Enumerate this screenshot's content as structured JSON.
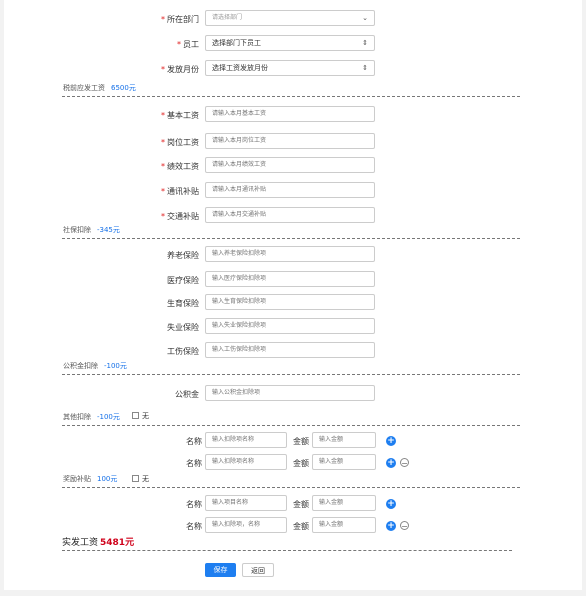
{
  "form": {
    "dept": {
      "label": "所在部门",
      "placeholder": "请选择部门",
      "icon": "chevron-down-icon"
    },
    "employee": {
      "label": "员工",
      "value": "选择部门下员工",
      "icon": "up-down-arrows-icon"
    },
    "month": {
      "label": "发放月份",
      "value": "选择工资发放月份",
      "icon": "up-down-arrows-icon"
    }
  },
  "pretax": {
    "label": "税前应发工资",
    "value": "6500元"
  },
  "income": [
    {
      "label": "基本工资",
      "placeholder": "请输入本月基本工资"
    },
    {
      "label": "岗位工资",
      "placeholder": "请输入本月岗位工资"
    },
    {
      "label": "绩效工资",
      "placeholder": "请输入本月绩效工资"
    },
    {
      "label": "通讯补贴",
      "placeholder": "请输入本月通讯补贴"
    },
    {
      "label": "交通补贴",
      "placeholder": "请输入本月交通补贴"
    }
  ],
  "social": {
    "label": "社保扣除",
    "value": "-345元"
  },
  "social_items": [
    {
      "label": "养老保险",
      "placeholder": "输入养老保险扣除项"
    },
    {
      "label": "医疗保险",
      "placeholder": "输入医疗保险扣除项"
    },
    {
      "label": "生育保险",
      "placeholder": "输入生育保险扣除项"
    },
    {
      "label": "失业保险",
      "placeholder": "输入失业保险扣除项"
    },
    {
      "label": "工伤保险",
      "placeholder": "输入工伤保险扣除项"
    }
  ],
  "fund": {
    "label": "公积金扣除",
    "value": "-100元",
    "item_label": "公积金",
    "item_placeholder": "输入公积金扣除项"
  },
  "other": {
    "label": "其他扣除",
    "value": "-100元",
    "none_label": "无",
    "rows": [
      {
        "name_label": "名称",
        "name_placeholder": "输入扣除项名称",
        "amount_label": "金额",
        "amount_placeholder": "输入金额"
      },
      {
        "name_label": "名称",
        "name_placeholder": "输入扣除项名称",
        "amount_label": "金额",
        "amount_placeholder": "输入金额"
      }
    ]
  },
  "bonus": {
    "label": "奖励补贴",
    "value": "100元",
    "none_label": "无",
    "rows": [
      {
        "name_label": "名称",
        "name_placeholder": "输入项目名称",
        "amount_label": "金额",
        "amount_placeholder": "输入金额"
      },
      {
        "name_label": "名称",
        "name_placeholder": "输入扣除项，名称",
        "amount_label": "金额",
        "amount_placeholder": "输入金额"
      }
    ]
  },
  "net": {
    "label": "实发工资",
    "value": "5481元"
  },
  "buttons": {
    "save": "保存",
    "back": "返回"
  },
  "colors": {
    "accent": "#1e7ef0",
    "required": "#e02020",
    "net": "#d0021b"
  }
}
